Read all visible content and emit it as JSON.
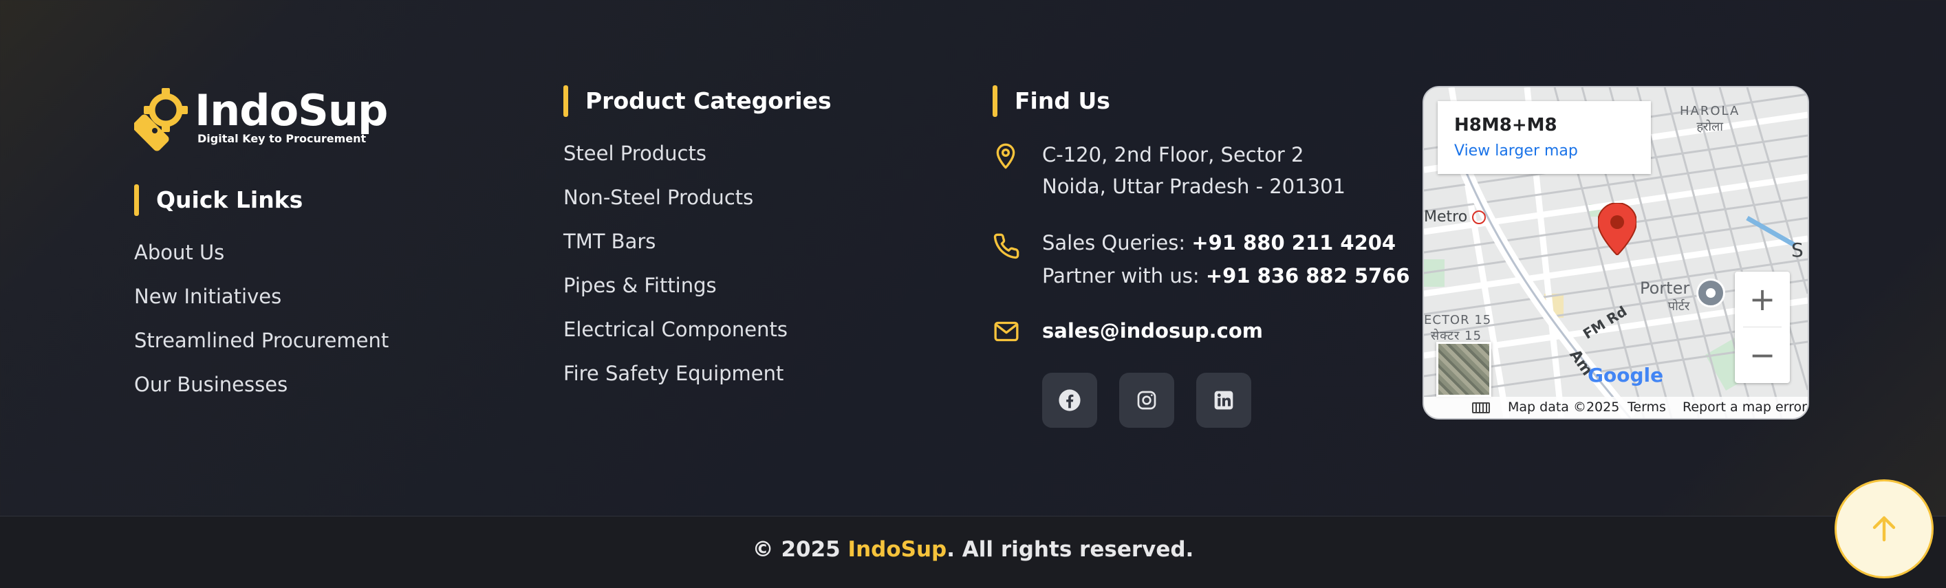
{
  "brand": {
    "name": "IndoSup",
    "tagline": "Digital Key to Procurement",
    "logo_icon": "wrench-gear-icon",
    "accent_color": "#f6c33b"
  },
  "quick_links": {
    "title": "Quick Links",
    "items": [
      "About Us",
      "New Initiatives",
      "Streamlined Procurement",
      "Our Businesses"
    ]
  },
  "product_categories": {
    "title": "Product Categories",
    "items": [
      "Steel Products",
      "Non-Steel Products",
      "TMT Bars",
      "Pipes & Fittings",
      "Electrical Components",
      "Fire Safety Equipment"
    ]
  },
  "find_us": {
    "title": "Find Us",
    "address_line1": "C-120, 2nd Floor, Sector 2",
    "address_line2": "Noida, Uttar Pradesh - 201301",
    "sales_label": "Sales Queries: ",
    "sales_phone": "+91 880 211 4204",
    "partner_label": "Partner with us: ",
    "partner_phone": "+91 836 882 5766",
    "email": "sales@indosup.com",
    "socials": [
      "facebook-icon",
      "instagram-icon",
      "linkedin-icon"
    ]
  },
  "map": {
    "plus_code": "H8M8+M8",
    "view_larger": "View larger map",
    "labels": {
      "harola_en": "HAROLA",
      "harola_hi": "हरोला",
      "metro": "Metro",
      "sector15_en": "ECTOR 15",
      "sector15_hi": "सेक्टर 15",
      "fm_rd": "FM Rd",
      "porter_en": "Porter",
      "porter_hi": "पोर्टर",
      "amb": "Am",
      "s_edge": "S",
      "google": "Google"
    },
    "footer": {
      "data": "Map data ©2025",
      "terms": "Terms",
      "report": "Report a map error"
    },
    "zoom_in": "+",
    "zoom_out": "−"
  },
  "footer": {
    "copyright_prefix": "© 2025 ",
    "copyright_brand": "IndoSup",
    "copyright_suffix": ". All rights reserved."
  }
}
